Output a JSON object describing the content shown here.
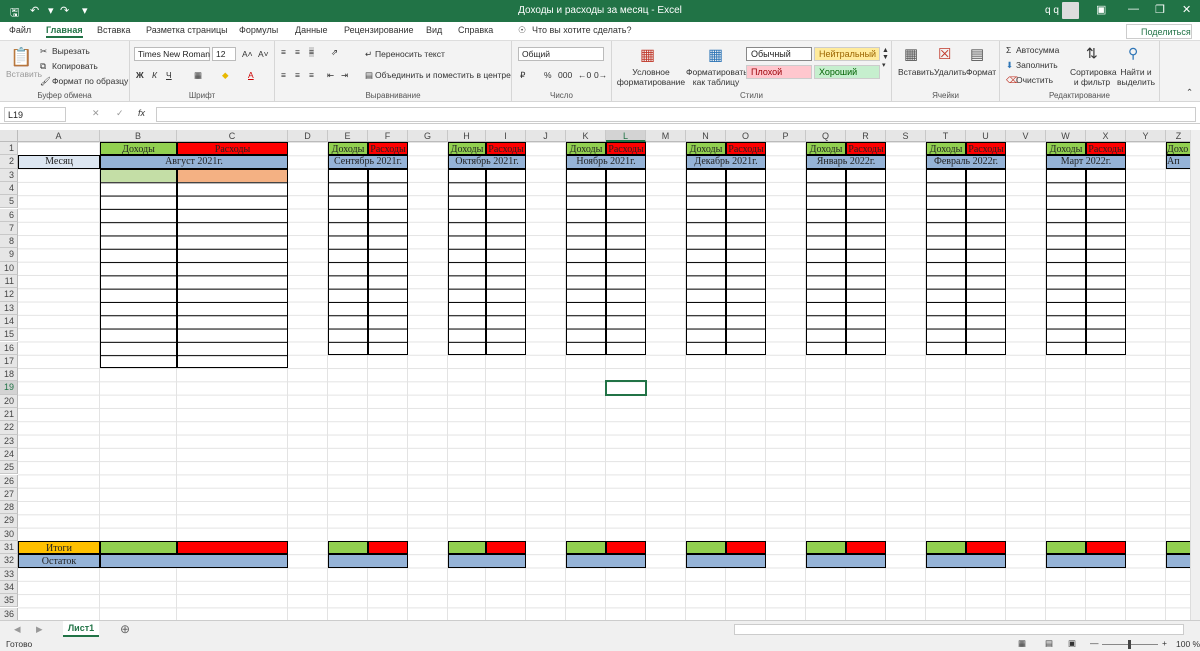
{
  "window": {
    "title": "Доходы и расходы за месяц  -  Excel",
    "user": "q q",
    "share": "Поделиться",
    "tell_me": "Что вы хотите сделать?"
  },
  "tabs": [
    "Файл",
    "Главная",
    "Вставка",
    "Разметка страницы",
    "Формулы",
    "Данные",
    "Рецензирование",
    "Вид",
    "Справка"
  ],
  "ribbon": {
    "clipboard": {
      "label": "Буфер обмена",
      "paste": "Вставить",
      "cut": "Вырезать",
      "copy": "Копировать",
      "format_painter": "Формат по образцу"
    },
    "font": {
      "label": "Шрифт",
      "name": "Times New Roman",
      "size": "12"
    },
    "alignment": {
      "label": "Выравнивание",
      "wrap": "Переносить текст",
      "merge": "Объединить и поместить в центре"
    },
    "number": {
      "label": "Число",
      "format": "Общий"
    },
    "styles": {
      "label": "Стили",
      "cond": "Условное форматирование",
      "table": "Форматировать как таблицу",
      "normal": "Обычный",
      "neutral": "Нейтральный",
      "bad": "Плохой",
      "good": "Хороший"
    },
    "cells": {
      "label": "Ячейки",
      "insert": "Вставить",
      "delete": "Удалить",
      "format": "Формат"
    },
    "editing": {
      "label": "Редактирование",
      "autosum": "Автосумма",
      "fill": "Заполнить",
      "clear": "Очистить",
      "sort": "Сортировка и фильтр",
      "find": "Найти и выделить"
    }
  },
  "namebox": "L19",
  "columns": [
    "A",
    "B",
    "C",
    "D",
    "E",
    "F",
    "G",
    "H",
    "I",
    "J",
    "K",
    "L",
    "M",
    "N",
    "O",
    "P",
    "Q",
    "R",
    "S",
    "T",
    "U",
    "V",
    "W",
    "X",
    "Y",
    "Z"
  ],
  "rows": [
    "1",
    "2",
    "3",
    "4",
    "5",
    "6",
    "7",
    "8",
    "9",
    "10",
    "11",
    "12",
    "13",
    "14",
    "15",
    "16",
    "17",
    "18",
    "19",
    "20",
    "21",
    "22",
    "23",
    "24",
    "25",
    "26",
    "27",
    "28",
    "29",
    "30",
    "31",
    "32",
    "33",
    "34",
    "35",
    "36"
  ],
  "sheet": {
    "month_label": "Месяц",
    "income": "Доходы",
    "expense": "Расходы",
    "totals": "Итоги",
    "balance": "Остаток",
    "months": [
      "Август 2021г.",
      "Сентябрь 2021г.",
      "Октябрь 2021г.",
      "Ноябрь 2021г.",
      "Декабрь 2021г.",
      "Январь 2022г.",
      "Февраль 2022г.",
      "Март 2022г.",
      "Ап"
    ],
    "partial_income": "Дохо"
  },
  "sheet_tab": "Лист1",
  "status": {
    "ready": "Готово",
    "zoom": "100 %"
  },
  "colors": {
    "income": "#92d050",
    "expense": "#ff0000",
    "month": "#95b3d7",
    "totals": "#ffc000",
    "light_green": "#c4dea6",
    "light_orange": "#f4b183"
  }
}
